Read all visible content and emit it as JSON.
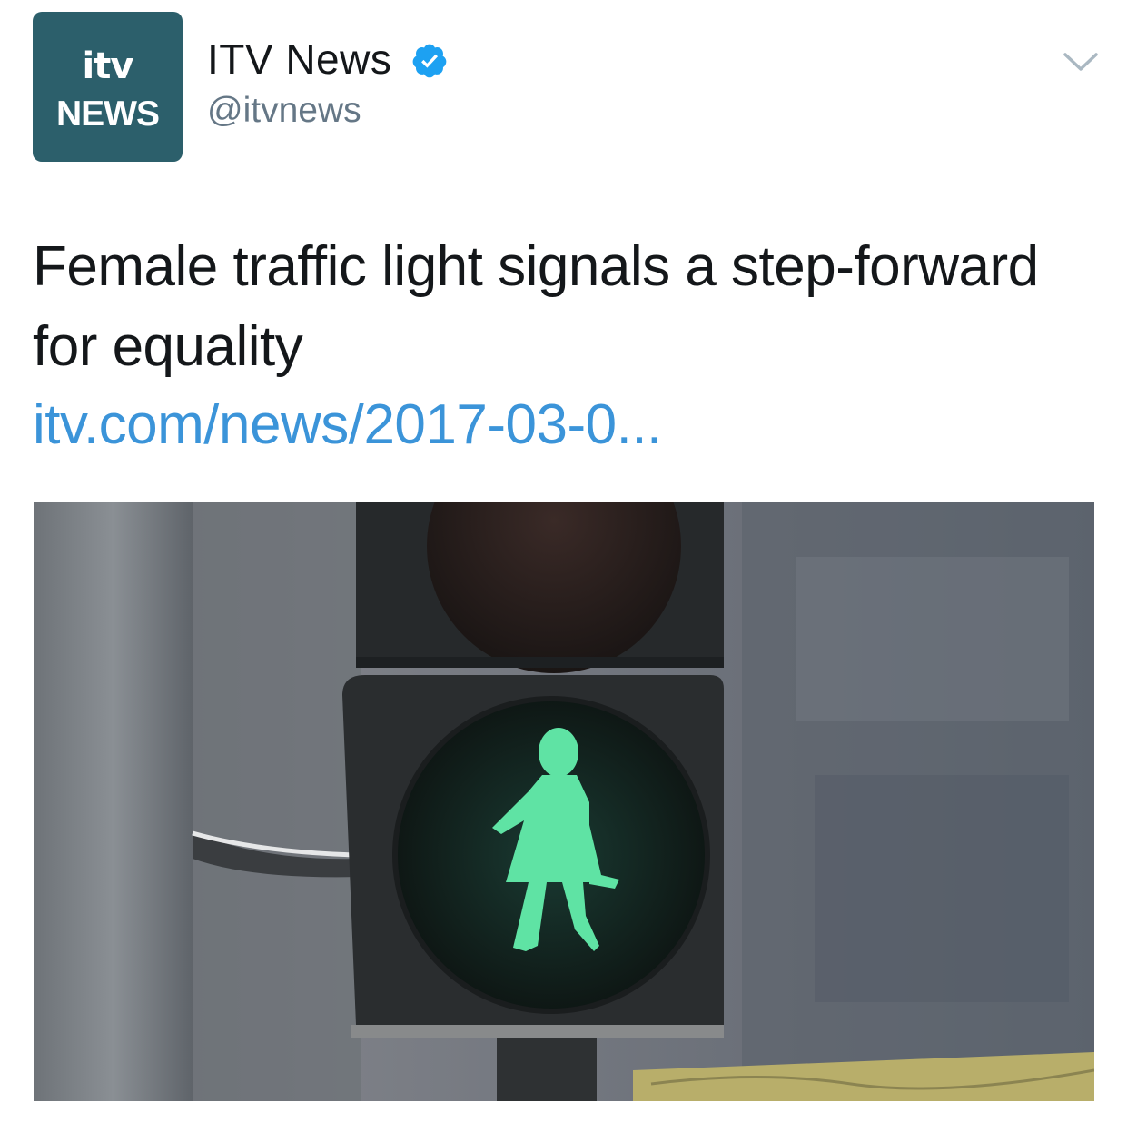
{
  "tweet": {
    "avatar": {
      "logo_line1": "itv",
      "logo_line2": "NEWS",
      "background": "#2c5f6b"
    },
    "display_name": "ITV News",
    "handle": "@itvnews",
    "verified_icon": "verified-badge-icon",
    "menu_icon": "chevron-down-icon",
    "text": "Female traffic light signals a step-forward for equality",
    "link": "itv.com/news/2017-03-0...",
    "link_color": "#3b94d9",
    "media_icon": "traffic-light-photo"
  }
}
